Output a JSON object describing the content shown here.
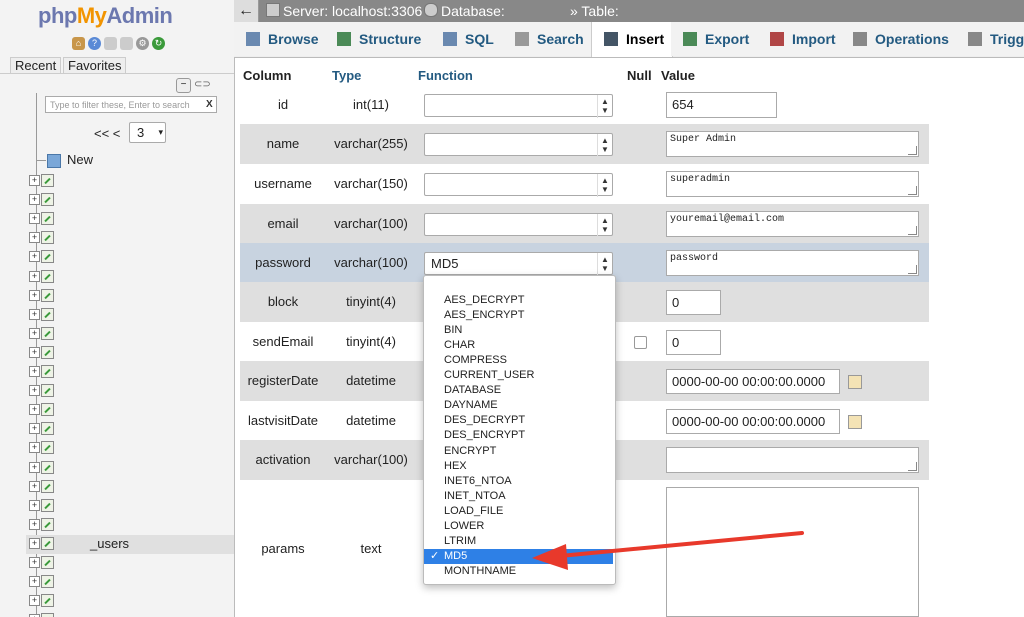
{
  "nav": {
    "logo_php": "php",
    "logo_my": "My",
    "logo_admin": "Admin",
    "recent_tab": "Recent",
    "favorites_tab": "Favorites",
    "filter_placeholder": "Type to filter these, Enter to search",
    "filter_clear": "X",
    "pager_prev": "<< <",
    "page_selected": "3",
    "new_label": "New",
    "highlighted_table": "_users"
  },
  "topbar": {
    "back_label": "←",
    "server": "Server: localhost:3306 »",
    "database": "Database:",
    "table": "» Table:"
  },
  "tabs": [
    {
      "label": "Browse",
      "icon": "browse-icon"
    },
    {
      "label": "Structure",
      "icon": "structure-icon"
    },
    {
      "label": "SQL",
      "icon": "sql-icon"
    },
    {
      "label": "Search",
      "icon": "search-icon"
    },
    {
      "label": "Insert",
      "icon": "insert-icon",
      "active": true
    },
    {
      "label": "Export",
      "icon": "export-icon"
    },
    {
      "label": "Import",
      "icon": "import-icon"
    },
    {
      "label": "Operations",
      "icon": "operations-icon"
    },
    {
      "label": "Trigg",
      "icon": "triggers-icon"
    }
  ],
  "headers": {
    "column": "Column",
    "type": "Type",
    "function": "Function",
    "null": "Null",
    "value": "Value"
  },
  "rows": [
    {
      "column": "id",
      "type": "int(11)",
      "function": "",
      "value": "654"
    },
    {
      "column": "name",
      "type": "varchar(255)",
      "function": "",
      "value": "Super Admin"
    },
    {
      "column": "username",
      "type": "varchar(150)",
      "function": "",
      "value": "superadmin"
    },
    {
      "column": "email",
      "type": "varchar(100)",
      "function": "",
      "value": "youremail@email.com"
    },
    {
      "column": "password",
      "type": "varchar(100)",
      "function": "MD5",
      "value": "password"
    },
    {
      "column": "block",
      "type": "tinyint(4)",
      "function": "",
      "value": "0"
    },
    {
      "column": "sendEmail",
      "type": "tinyint(4)",
      "function": "",
      "value": "0"
    },
    {
      "column": "registerDate",
      "type": "datetime",
      "function": "",
      "value": "0000-00-00 00:00:00.0000"
    },
    {
      "column": "lastvisitDate",
      "type": "datetime",
      "function": "",
      "value": "0000-00-00 00:00:00.0000"
    },
    {
      "column": "activation",
      "type": "varchar(100)",
      "function": "",
      "value": ""
    },
    {
      "column": "params",
      "type": "text",
      "function": "",
      "value": ""
    }
  ],
  "function_options": [
    "AES_DECRYPT",
    "AES_ENCRYPT",
    "BIN",
    "CHAR",
    "COMPRESS",
    "CURRENT_USER",
    "DATABASE",
    "DAYNAME",
    "DES_DECRYPT",
    "DES_ENCRYPT",
    "ENCRYPT",
    "HEX",
    "INET6_NTOA",
    "INET_NTOA",
    "LOAD_FILE",
    "LOWER",
    "LTRIM",
    "MD5",
    "MONTHNAME"
  ],
  "selected_function": "MD5",
  "colors": {
    "accent": "#2e80e6",
    "annotation_arrow": "#e8392b",
    "tab_text": "#235a81",
    "row_alt": "#dfdfdf",
    "row_selected": "#c8d3e0"
  }
}
